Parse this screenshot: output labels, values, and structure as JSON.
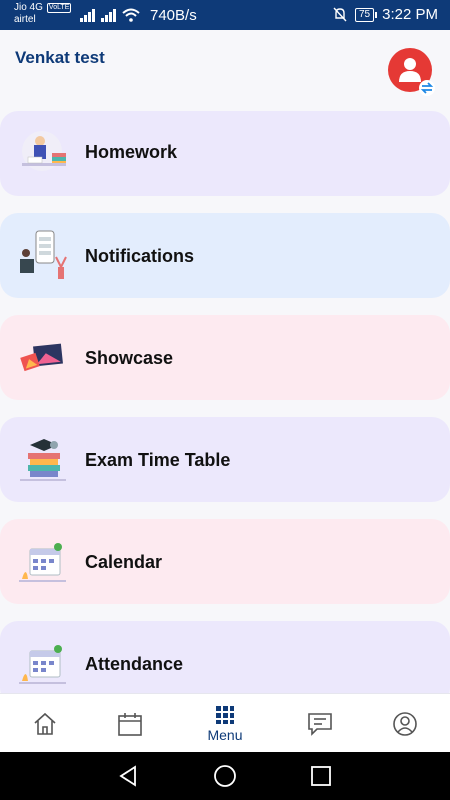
{
  "status_bar": {
    "carrier_1": "Jio 4G",
    "volte": "VoLTE",
    "carrier_2": "airtel",
    "speed": "740B/s",
    "battery": "75",
    "time": "3:22 PM"
  },
  "header": {
    "title": "Venkat test"
  },
  "menu_items": [
    {
      "label": "Homework",
      "bg": "#ece8fc"
    },
    {
      "label": "Notifications",
      "bg": "#e3edfd"
    },
    {
      "label": "Showcase",
      "bg": "#fdeaf0"
    },
    {
      "label": "Exam Time Table",
      "bg": "#ece8fc"
    },
    {
      "label": "Calendar",
      "bg": "#fdeaf0"
    },
    {
      "label": "Attendance",
      "bg": "#ece8fc"
    }
  ],
  "bottom_nav": {
    "home_icon": "home-icon",
    "calendar_icon": "calendar-icon",
    "menu_label": "Menu",
    "chat_icon": "chat-icon",
    "profile_icon": "profile-icon",
    "active_color": "#0e3a78"
  }
}
